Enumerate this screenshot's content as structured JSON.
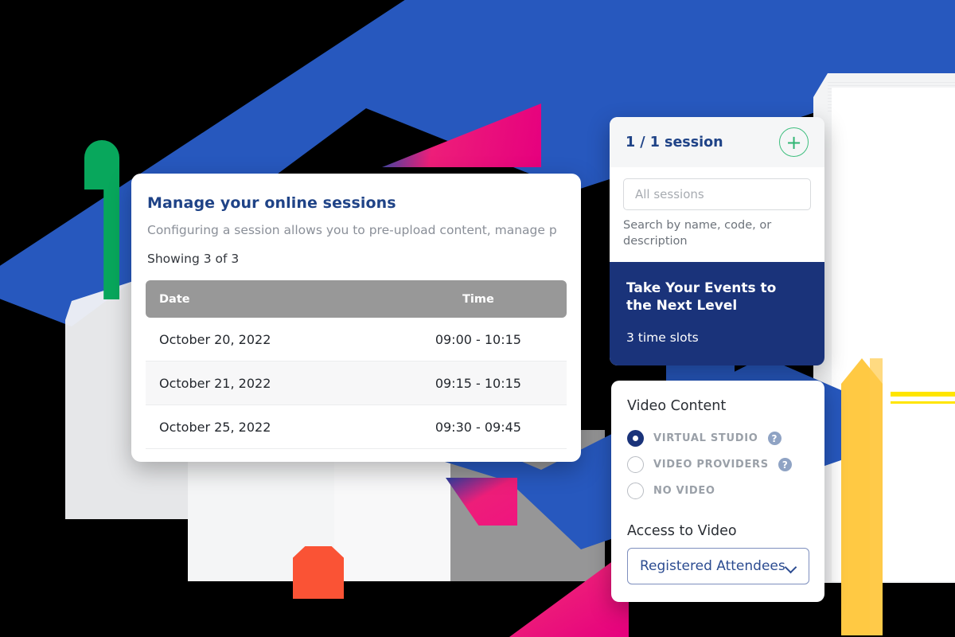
{
  "colors": {
    "brand_blue": "#2758BE",
    "deep_navy": "#1A337A",
    "title_blue": "#1F4387",
    "green": "#08A75C",
    "green_accent": "#3FBF7F",
    "magenta": "#ED1E79",
    "orange": "#FA5335",
    "yellow": "#FFC943",
    "yellow_line": "#FFE500",
    "table_header_gray": "#989898"
  },
  "sessions_card": {
    "title": "Manage your online sessions",
    "description": "Configuring a session allows you to pre-upload content, manage p",
    "showing": "Showing 3 of 3",
    "table": {
      "columns": [
        "Date",
        "Time"
      ],
      "rows": [
        {
          "date": "October 20, 2022",
          "time": "09:00 - 10:15"
        },
        {
          "date": "October 21, 2022",
          "time": "09:15 - 10:15"
        },
        {
          "date": "October 25, 2022",
          "time": "09:30 - 09:45"
        }
      ]
    }
  },
  "side_panel": {
    "header_title": "1 / 1 session",
    "add_button_icon": "plus-icon",
    "search_placeholder": "All sessions",
    "search_value": "",
    "search_hint": "Search by name, code, or description",
    "session": {
      "name": "Take Your Events to the Next Level",
      "slots": "3 time slots"
    }
  },
  "video_card": {
    "title": "Video Content",
    "options": [
      {
        "label": "VIRTUAL STUDIO",
        "selected": true,
        "has_help": true,
        "help_icon": "question-mark-icon"
      },
      {
        "label": "VIDEO PROVIDERS",
        "selected": false,
        "has_help": true,
        "help_icon": "question-mark-icon"
      },
      {
        "label": "NO VIDEO",
        "selected": false,
        "has_help": false,
        "help_icon": ""
      }
    ],
    "access_label": "Access to Video",
    "access_value": "Registered Attendees",
    "access_chevron_icon": "chevron-down-icon"
  }
}
